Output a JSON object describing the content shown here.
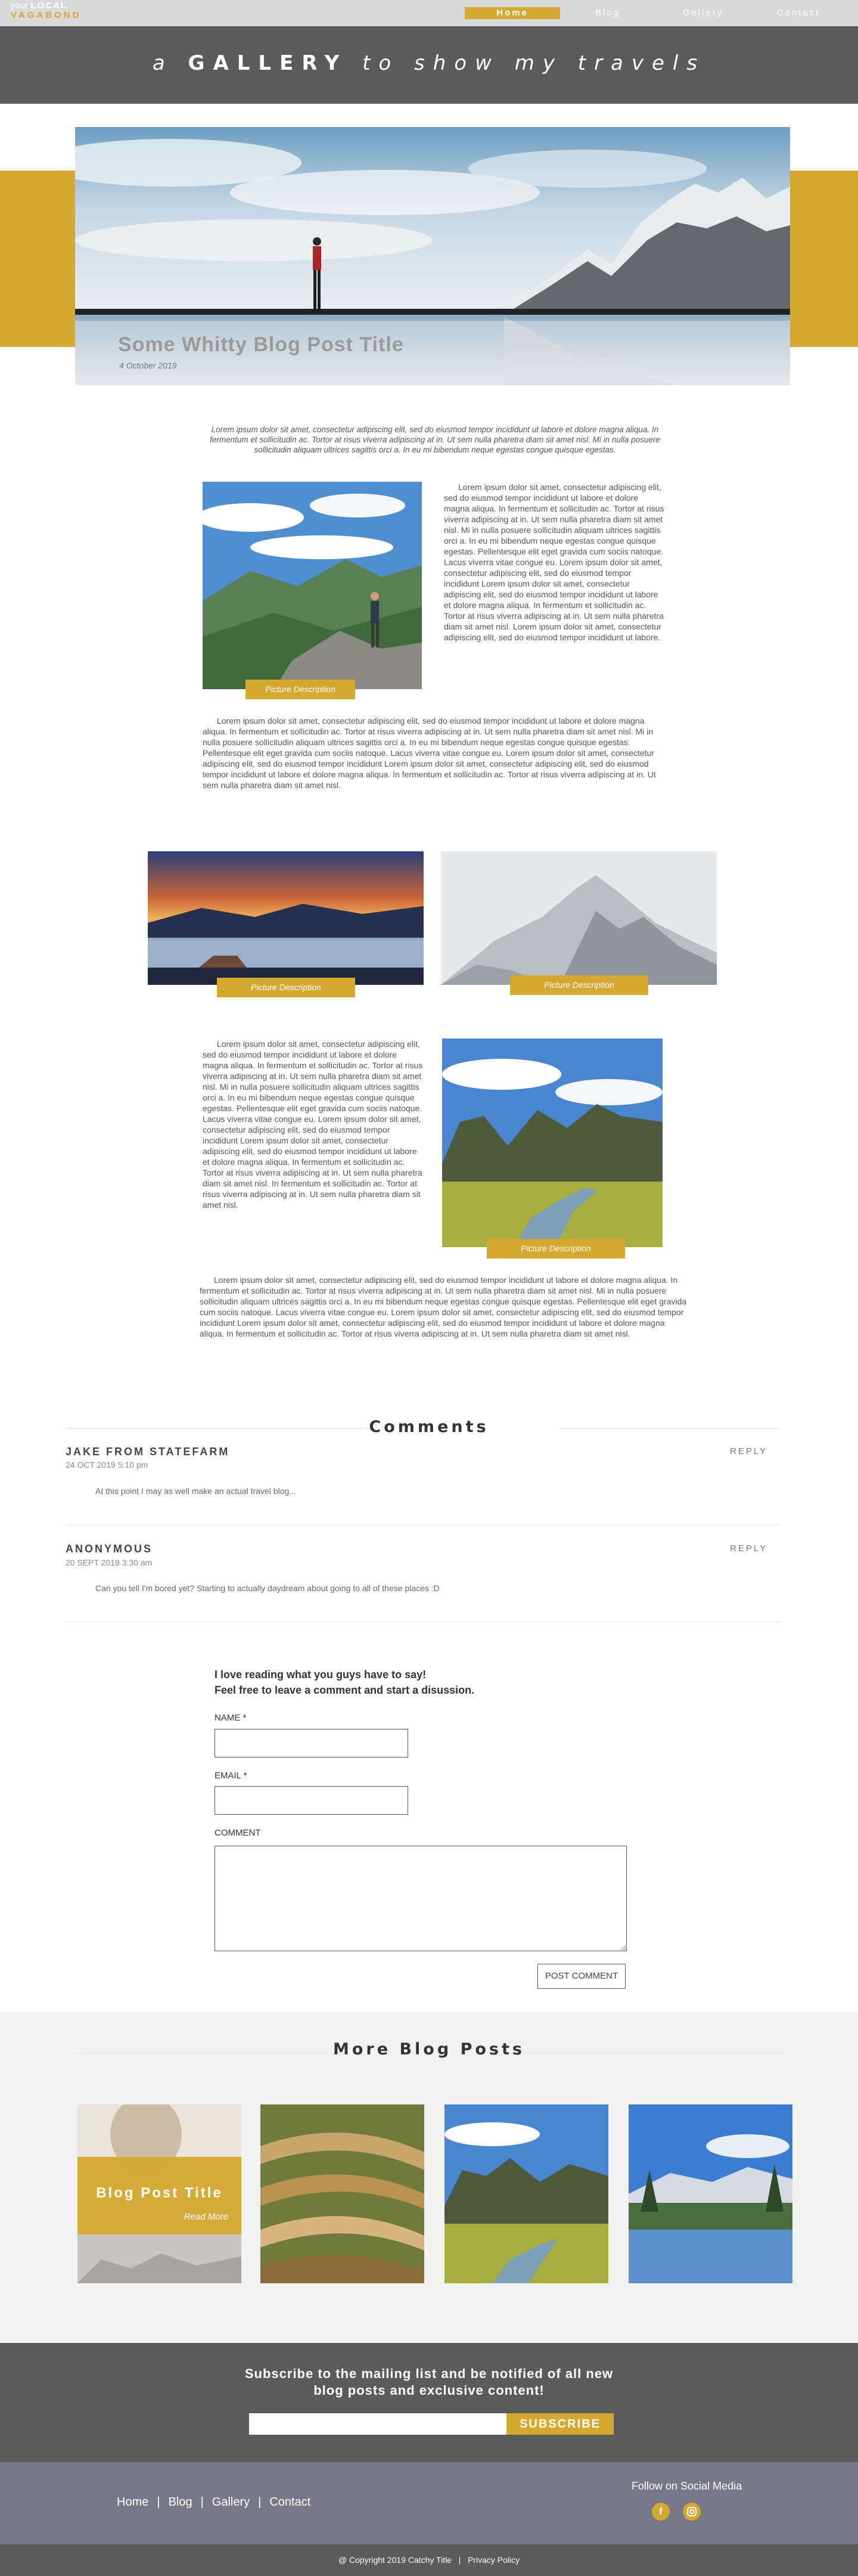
{
  "nav": {
    "logo_prefix": "your",
    "logo_word": "LOCAL",
    "logo_second": "VAGABOND",
    "items": [
      {
        "label": "Home",
        "active": true
      },
      {
        "label": "Blog",
        "active": false
      },
      {
        "label": "Gallery",
        "active": false
      },
      {
        "label": "Contact",
        "active": false
      }
    ]
  },
  "banner": {
    "pre": "a",
    "word": "GALLERY",
    "post": "to show my travels"
  },
  "hero": {
    "title": "Some Whitty Blog Post Title",
    "date": "4 October 2019"
  },
  "article": {
    "intro": "Lorem ipsum dolor sit amet, consectetur adipiscing elit, sed do eiusmod tempor incididunt ut labore et dolore magna aliqua. In fermentum et sollicitudin ac. Tortor at risus viverra adipiscing at in. Ut sem nulla pharetra diam sit amet nisl. Mi in nulla posuere sollicitudin aliquam ultrices sagittis orci a. In eu mi bibendum neque egestas congue quisque egestas.",
    "p1": "Lorem ipsum dolor sit amet, consectetur adipiscing elit, sed do eiusmod tempor incididunt ut labore et dolore magna aliqua. In fermentum et sollicitudin ac. Tortor at risus viverra adipiscing at in. Ut sem nulla pharetra diam sit amet nisl. Mi in nulla posuere sollicitudin aliquam ultrices sagittis orci a. In eu mi bibendum neque egestas congue quisque egestas. Pellentesque elit eget gravida cum sociis natoque. Lacus viverra vitae congue eu. Lorem ipsum dolor sit amet, consectetur adipiscing elit, sed do eiusmod tempor incididunt Lorem ipsum dolor sit amet, consectetur adipiscing elit, sed do eiusmod tempor incididunt ut labore et dolore magna aliqua. In fermentum et sollicitudin ac. Tortor at risus viverra adipiscing at in. Ut sem nulla pharetra diam sit amet nisl. Lorem ipsum dolor sit amet, consectetur adipiscing elit, sed do eiusmod tempor incididunt ut labore.",
    "p2": "Lorem ipsum dolor sit amet, consectetur adipiscing elit, sed do eiusmod tempor incididunt ut labore et dolore magna aliqua. In fermentum et sollicitudin ac. Tortor at risus viverra adipiscing at in. Ut sem nulla pharetra diam sit amet nisl. Mi in nulla posuere sollicitudin aliquam ultrices sagittis orci a. In eu mi bibendum neque egestas congue quisque egestas. Pellentesque elit eget gravida cum sociis natoque. Lacus viverra vitae congue eu. Lorem ipsum dolor sit amet, consectetur adipiscing elit, sed do eiusmod tempor incididunt Lorem ipsum dolor sit amet, consectetur adipiscing elit, sed do eiusmod tempor incididunt ut labore et dolore magna aliqua. In fermentum et sollicitudin ac. Tortor at risus viverra adipiscing at in. Ut sem nulla pharetra diam sit amet nisl.",
    "p3": "Lorem ipsum dolor sit amet, consectetur adipiscing elit, sed do eiusmod tempor incididunt ut labore et dolore magna aliqua. In fermentum et sollicitudin ac. Tortor at risus viverra adipiscing at in. Ut sem nulla pharetra diam sit amet nisl. Mi in nulla posuere sollicitudin aliquam ultrices sagittis orci a. In eu mi bibendum neque egestas congue quisque egestas. Pellentesque elit eget gravida cum sociis natoque. Lacus viverra vitae congue eu. Lorem ipsum dolor sit amet, consectetur adipiscing elit, sed do eiusmod tempor incididunt Lorem ipsum dolor sit amet, consectetur adipiscing elit, sed do eiusmod tempor incididunt ut labore et dolore magna aliqua. In fermentum et sollicitudin ac. Tortor at risus viverra adipiscing at in. Ut sem nulla pharetra diam sit amet nisl. In fermentum et sollicitudin ac. Tortor at risus viverra adipiscing at in. Ut sem nulla pharetra diam sit amet nisl.",
    "p4": "Lorem ipsum dolor sit amet, consectetur adipiscing elit, sed do eiusmod tempor incididunt ut labore et dolore magna aliqua. In fermentum et sollicitudin ac. Tortor at risus viverra adipiscing at in. Ut sem nulla pharetra diam sit amet nisl. Mi in nulla posuere sollicitudin aliquam ultrices sagittis orci a. In eu mi bibendum neque egestas congue quisque egestas. Pellentesque elit eget gravida cum sociis natoque. Lacus viverra vitae congue eu. Lorem ipsum dolor sit amet, consectetur adipiscing elit, sed do eiusmod tempor incididunt Lorem ipsum dolor sit amet, consectetur adipiscing elit, sed do eiusmod tempor incididunt ut labore et dolore magna aliqua. In fermentum et sollicitudin ac. Tortor at risus viverra adipiscing at in. Ut sem nulla pharetra diam sit amet nisl.",
    "caption": "Picture Description"
  },
  "comments": {
    "title": "Comments",
    "reply_label": "REPLY",
    "items": [
      {
        "name": "JAKE FROM STATEFARM",
        "date": "24 OCT 2019 5:10 pm",
        "text": "At this point I may as well make an actual travel blog..."
      },
      {
        "name": "ANONYMOUS",
        "date": "20 SEPT 2019 3:30 am",
        "text": "Can you tell I'm bored yet? Starting to actually daydream about going to all of these places :D"
      }
    ]
  },
  "form": {
    "intro_line1": "I love reading what you guys have to say!",
    "intro_line2": "Feel free to leave a comment and start a disussion.",
    "name_label": "NAME *",
    "email_label": "EMAIL *",
    "comment_label": "COMMENT",
    "submit_label": "POST COMMENT"
  },
  "more_posts": {
    "title": "More Blog Posts",
    "card_title": "Blog Post Title",
    "card_more": "Read More"
  },
  "subscribe": {
    "line1": "Subscribe to the mailing list and be notified of all new",
    "line2": "blog posts and exclusive content!",
    "button": "SUBSCRIBE"
  },
  "footer": {
    "links": [
      "Home",
      "Blog",
      "Gallery",
      "Contact"
    ],
    "separator": "|",
    "social_title": "Follow on Social Media",
    "social_icons": [
      "facebook-icon",
      "instagram-icon"
    ],
    "copyright": "@ Copyright 2019 Catchy Title",
    "privacy": "Privacy Policy"
  },
  "colors": {
    "accent": "#d4a831",
    "dark": "#5b5b5b",
    "footer": "#787887",
    "nav": "#d9d9d9"
  }
}
